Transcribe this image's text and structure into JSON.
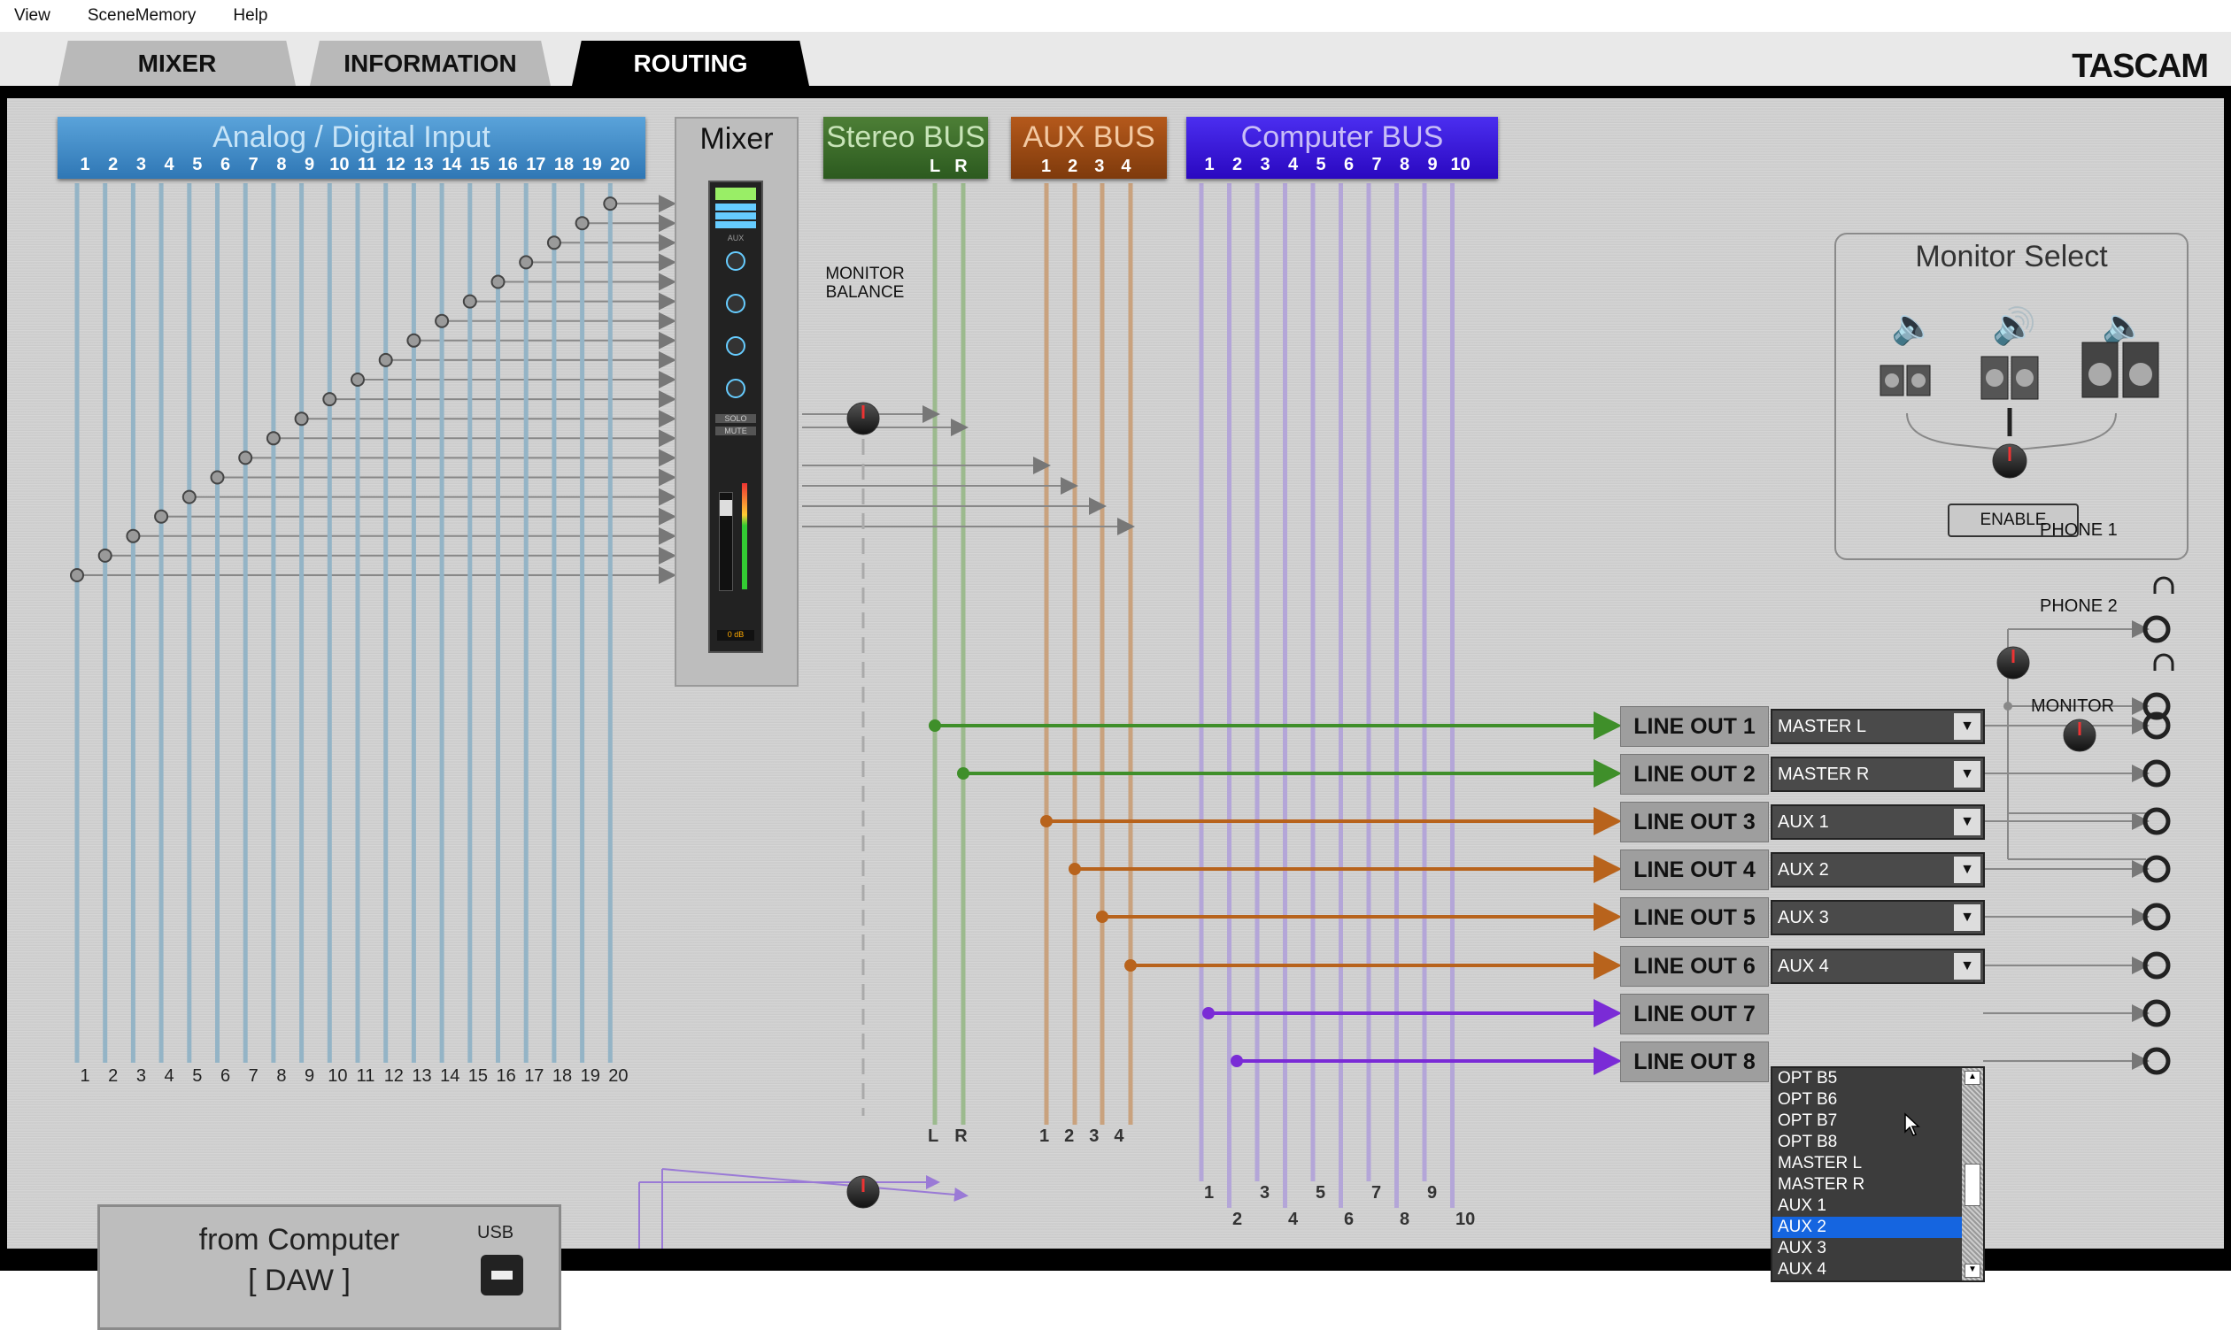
{
  "menu": [
    "View",
    "SceneMemory",
    "Help"
  ],
  "tabs": [
    {
      "label": "MIXER",
      "active": false
    },
    {
      "label": "INFORMATION",
      "active": false
    },
    {
      "label": "ROUTING",
      "active": true
    }
  ],
  "brand": "TASCAM",
  "buses": {
    "input": {
      "title": "Analog / Digital Input",
      "channels": [
        "1",
        "2",
        "3",
        "4",
        "5",
        "6",
        "7",
        "8",
        "9",
        "10",
        "11",
        "12",
        "13",
        "14",
        "15",
        "16",
        "17",
        "18",
        "19",
        "20"
      ],
      "color": "#3b86c4"
    },
    "mixer": {
      "title": "Mixer"
    },
    "stereo": {
      "title": "Stereo BUS",
      "channels": [
        "L",
        "R"
      ],
      "color": "#3d6a2b"
    },
    "aux": {
      "title": "AUX BUS",
      "channels": [
        "1",
        "2",
        "3",
        "4"
      ],
      "color": "#9a4a16"
    },
    "computer": {
      "title": "Computer BUS",
      "channels": [
        "1",
        "2",
        "3",
        "4",
        "5",
        "6",
        "7",
        "8",
        "9",
        "10"
      ],
      "color": "#3a18e0"
    }
  },
  "monitor_balance_label": "MONITOR BALANCE",
  "stereo_bottom": [
    "L",
    "R"
  ],
  "aux_bottom": [
    "1",
    "2",
    "3",
    "4"
  ],
  "computer_bottom_top": [
    "1",
    "3",
    "5",
    "7",
    "9"
  ],
  "computer_bottom_bottom": [
    "2",
    "4",
    "6",
    "8",
    "10"
  ],
  "monitor_select": {
    "title": "Monitor Select",
    "enable_label": "ENABLE"
  },
  "phones": [
    "PHONE 1",
    "PHONE 2"
  ],
  "monitor_label": "MONITOR",
  "line_outs": [
    {
      "label": "LINE OUT 1",
      "value": "MASTER L",
      "color": "#3f8f2a"
    },
    {
      "label": "LINE OUT 2",
      "value": "MASTER R",
      "color": "#3f8f2a"
    },
    {
      "label": "LINE OUT 3",
      "value": "AUX 1",
      "color": "#b8631c"
    },
    {
      "label": "LINE OUT 4",
      "value": "AUX 2",
      "color": "#b8631c"
    },
    {
      "label": "LINE OUT 5",
      "value": "AUX 3",
      "color": "#b8631c"
    },
    {
      "label": "LINE OUT 6",
      "value": "AUX 4",
      "color": "#b8631c"
    },
    {
      "label": "LINE OUT 7",
      "value": "",
      "color": "#7a2bd6"
    },
    {
      "label": "LINE OUT 8",
      "value": "",
      "color": "#7a2bd6"
    }
  ],
  "dropdown": {
    "items": [
      "OPT B5",
      "OPT B6",
      "OPT B7",
      "OPT B8",
      "MASTER L",
      "MASTER R",
      "AUX 1",
      "AUX 2",
      "AUX 3",
      "AUX 4"
    ],
    "highlighted": "AUX 2"
  },
  "from_computer": {
    "title": "from Computer",
    "subtitle": "[ DAW ]",
    "usb_label": "USB"
  },
  "mixer_strip": {
    "aux_label": "AUX",
    "solo": "SOLO",
    "mute": "MUTE",
    "db": "0 dB"
  }
}
